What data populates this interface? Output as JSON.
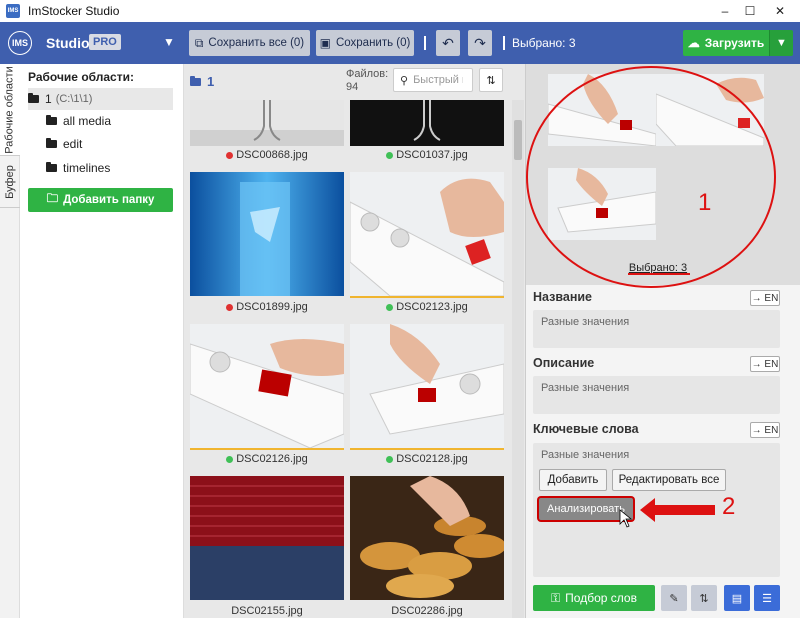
{
  "window": {
    "title": "ImStocker Studio",
    "icon_text": "IMS",
    "minimize": "–",
    "maximize": "☐",
    "close": "✕"
  },
  "toolbar": {
    "logo": "IMS",
    "app_name": "Studio",
    "edition": "PRO",
    "save_all": "Сохранить все (0)",
    "save": "Сохранить (0)",
    "selected": "Выбрано: 3",
    "upload": "Загрузить",
    "accent_color": "#3f5fae",
    "upload_color": "#2fb344"
  },
  "side_tabs": [
    "Рабочие области",
    "Буфер"
  ],
  "workspaces": {
    "title": "Рабочие области:",
    "root": {
      "name": "1",
      "path": "(C:\\1\\1)"
    },
    "folders": [
      "all media",
      "edit",
      "timelines"
    ],
    "add_folder": "Добавить папку"
  },
  "gallery": {
    "folder": "1",
    "files_label": "Файлов:",
    "files_count": "94",
    "search_placeholder": "Быстрый поиск",
    "tiles": [
      {
        "name": "DSC00868.jpg",
        "status": "red",
        "selected": false
      },
      {
        "name": "DSC01037.jpg",
        "status": "green",
        "selected": false
      },
      {
        "name": "DSC01899.jpg",
        "status": "red",
        "selected": false
      },
      {
        "name": "DSC02123.jpg",
        "status": "green",
        "selected": true
      },
      {
        "name": "DSC02126.jpg",
        "status": "green",
        "selected": true
      },
      {
        "name": "DSC02128.jpg",
        "status": "green",
        "selected": true
      },
      {
        "name": "DSC02155.jpg",
        "status": "none",
        "selected": false
      },
      {
        "name": "DSC02286.jpg",
        "status": "none",
        "selected": false
      }
    ],
    "status_colors": {
      "red": "#e03131",
      "green": "#40c057"
    }
  },
  "properties": {
    "preview_selected": "Выбрано: 3",
    "title_label": "Название",
    "title_value": "Разные значения",
    "description_label": "Описание",
    "description_value": "Разные значения",
    "keywords_label": "Ключевые слова",
    "keywords_value": "Разные значения",
    "translate_btn": "→ EN",
    "add_btn": "Добавить",
    "edit_all_btn": "Редактировать все",
    "analyze_btn": "Анализировать",
    "word_select_btn": "Подбор слов"
  },
  "annotations": {
    "marker_1": "1",
    "marker_2": "2",
    "color": "#d11"
  }
}
